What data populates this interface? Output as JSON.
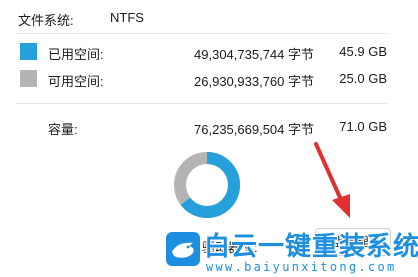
{
  "filesystem": {
    "label": "文件系统:",
    "value": "NTFS"
  },
  "used": {
    "label": "已用空间:",
    "bytes": "49,304,735,744 字节",
    "size": "45.9 GB",
    "color": "#26a0da"
  },
  "free": {
    "label": "可用空间:",
    "bytes": "26,930,933,760 字节",
    "size": "25.0 GB",
    "color": "#b4b4b4"
  },
  "capacity": {
    "label": "容量:",
    "bytes": "76,235,669,504 字节",
    "size": "71.0 GB"
  },
  "usage": {
    "used_fraction": 0.646
  },
  "drive": {
    "label": "驱动器 C:"
  },
  "cleanup_button": {
    "label": "磁盘清理(D)"
  },
  "watermark": {
    "title": "白云一键重装系统",
    "url": "www.baiyunxitong.com"
  },
  "icons": {
    "pointer": "red-arrow-icon",
    "logo": "bird-logo-icon"
  }
}
